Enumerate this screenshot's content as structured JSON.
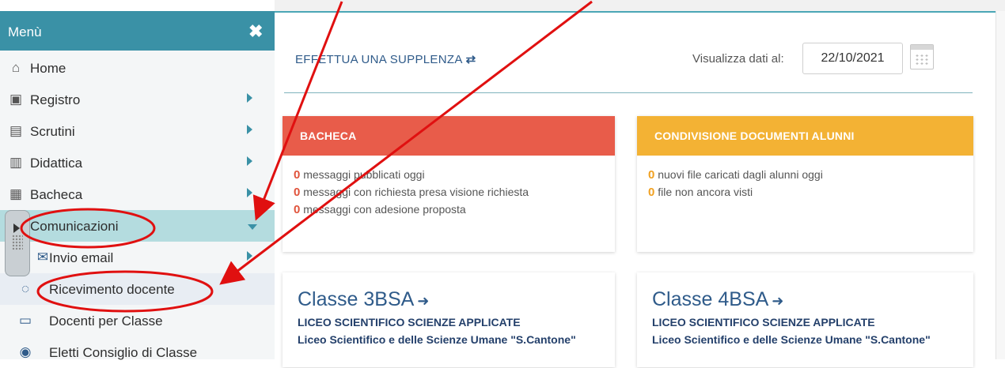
{
  "sidebar": {
    "title": "Menù",
    "close_symbol": "✖",
    "items": [
      {
        "label": "Home",
        "icon": "home-icon",
        "glyph": "⌂"
      },
      {
        "label": "Registro",
        "icon": "calendar-check-icon",
        "glyph": "▣"
      },
      {
        "label": "Scrutini",
        "icon": "document-icon",
        "glyph": "▤"
      },
      {
        "label": "Didattica",
        "icon": "book-icon",
        "glyph": "▥"
      },
      {
        "label": "Bacheca",
        "icon": "notice-board-icon",
        "glyph": "▦"
      },
      {
        "label": "Comunicazioni",
        "icon": "comunicazioni-icon",
        "glyph": ""
      },
      {
        "label": "Invio email",
        "icon": "envelope-icon",
        "glyph": "✉"
      },
      {
        "label": "Ricevimento docente",
        "icon": "chat-icon",
        "glyph": "◌"
      },
      {
        "label": "Docenti per Classe",
        "icon": "chalkboard-icon",
        "glyph": "▭"
      },
      {
        "label": "Eletti Consiglio di Classe",
        "icon": "users-icon",
        "glyph": "◉"
      }
    ]
  },
  "header": {
    "supplenza_label": "EFFETTUA UNA SUPPLENZA",
    "supplenza_glyph": "⇄",
    "visualizza_label": "Visualizza dati al:",
    "date_value": "22/10/2021"
  },
  "bacheca": {
    "title": "BACHECA",
    "color": "#e85c4a",
    "lines": [
      {
        "count": "0",
        "text": "messaggi pubblicati oggi"
      },
      {
        "count": "0",
        "text": "messaggi con richiesta presa visione richiesta"
      },
      {
        "count": "0",
        "text": "messaggi con adesione proposta"
      }
    ]
  },
  "condivisione": {
    "title": "CONDIVISIONE DOCUMENTI ALUNNI",
    "color": "#f3b234",
    "lines": [
      {
        "count": "0",
        "text": "nuovi file caricati dagli alunni oggi"
      },
      {
        "count": "0",
        "text": "file non ancora visti"
      }
    ]
  },
  "classes": [
    {
      "name": "Classe 3BSA",
      "glyph": "➜",
      "indirizzo": "LICEO SCIENTIFICO SCIENZE APPLICATE",
      "scuola": "Liceo Scientifico e delle Scienze Umane \"S.Cantone\""
    },
    {
      "name": "Classe 4BSA",
      "glyph": "➜",
      "indirizzo": "LICEO SCIENTIFICO SCIENZE APPLICATE",
      "scuola": "Liceo Scientifico e delle Scienze Umane \"S.Cantone\""
    }
  ],
  "annotation_color": "#e01010"
}
